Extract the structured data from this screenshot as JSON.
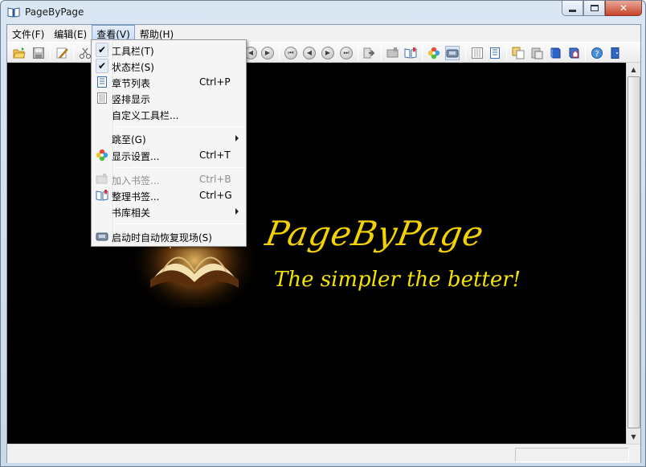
{
  "window": {
    "title": "PageByPage"
  },
  "menubar": [
    {
      "label": "文件(F)"
    },
    {
      "label": "编辑(E)"
    },
    {
      "label": "查看(V)"
    },
    {
      "label": "帮助(H)"
    }
  ],
  "view_menu": {
    "items": [
      {
        "label": "工具栏(T)",
        "shortcut": "",
        "checked": true,
        "icon": "check-icon"
      },
      {
        "label": "状态栏(S)",
        "shortcut": "",
        "checked": true,
        "icon": "check-icon"
      },
      {
        "label": "章节列表",
        "shortcut": "Ctrl+P",
        "icon": "chapter-list-icon"
      },
      {
        "label": "竖排显示",
        "shortcut": "",
        "icon": "vertical-layout-icon"
      },
      {
        "label": "自定义工具栏...",
        "shortcut": ""
      },
      {
        "label": "跳至(G)",
        "shortcut": "",
        "submenu": true
      },
      {
        "label": "显示设置...",
        "shortcut": "Ctrl+T",
        "icon": "display-settings-icon"
      },
      {
        "label": "加入书签...",
        "shortcut": "Ctrl+B",
        "disabled": true,
        "icon": "add-bookmark-icon"
      },
      {
        "label": "整理书签...",
        "shortcut": "Ctrl+G",
        "icon": "organize-bookmarks-icon"
      },
      {
        "label": "书库相关",
        "shortcut": "",
        "submenu": true
      },
      {
        "label": "启动时自动恢复现场(S)",
        "shortcut": "",
        "icon": "restore-session-icon"
      }
    ]
  },
  "splash": {
    "brand": "PageByPage",
    "slogan": "The simpler the better!",
    "brand_color": "#f4d100"
  },
  "colors": {
    "content_bg": "#000000",
    "menu_bg": "#f5f5f5"
  }
}
